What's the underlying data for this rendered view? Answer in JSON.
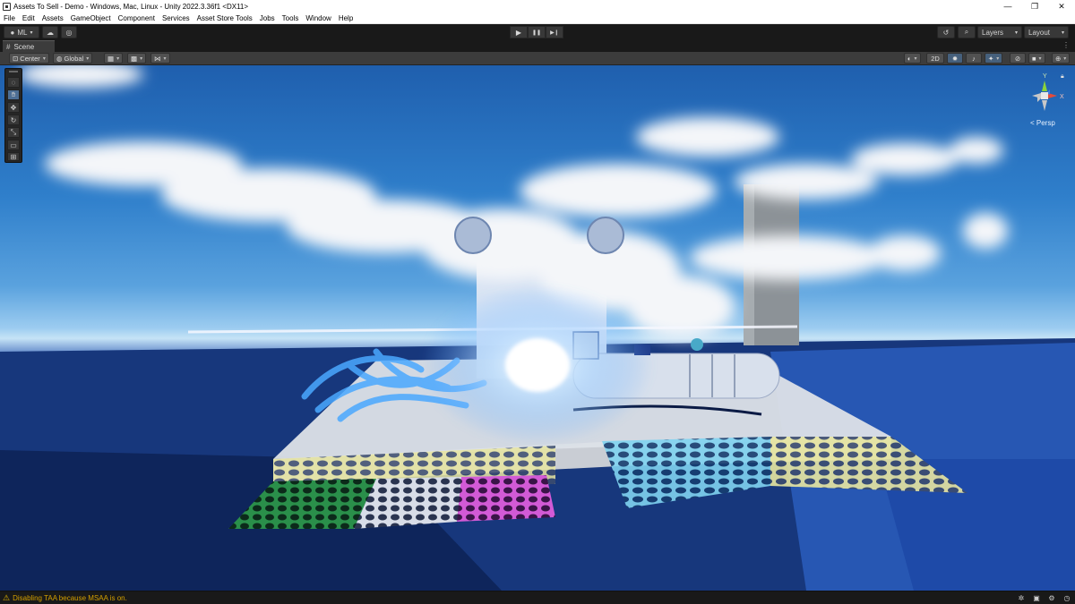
{
  "window": {
    "title": "Assets To Sell - Demo - Windows, Mac, Linux - Unity 2022.3.36f1 <DX11>",
    "controls": {
      "minimize": "—",
      "maximize": "❐",
      "close": "✕"
    }
  },
  "menu": [
    "File",
    "Edit",
    "Assets",
    "GameObject",
    "Component",
    "Services",
    "Asset Store Tools",
    "Jobs",
    "Tools",
    "Window",
    "Help"
  ],
  "toolbar": {
    "account_label": "ML",
    "account_caret": "▾",
    "play_icons": {
      "play": "▶",
      "pause": "❚❚",
      "step": "▶❙"
    },
    "layers_label": "Layers",
    "layout_label": "Layout",
    "caret": "▾"
  },
  "tab": {
    "scene_label": "Scene",
    "menu_glyph": "⋮"
  },
  "scene_toolbar": {
    "pivot_label": "Center",
    "space_label": "Global",
    "toggle_2d_label": "2D"
  },
  "viewport": {
    "projection_label": "< Persp",
    "gizmo_x_label": "X",
    "gizmo_y_label": "Y"
  },
  "status": {
    "warning_icon": "⚠",
    "message": "Disabling TAA because MSAA is on."
  },
  "colors": {
    "accent_blue": "#46607c",
    "warning": "#d4a000",
    "sky_top": "#1f5fae",
    "floor": "#0f2a63"
  }
}
